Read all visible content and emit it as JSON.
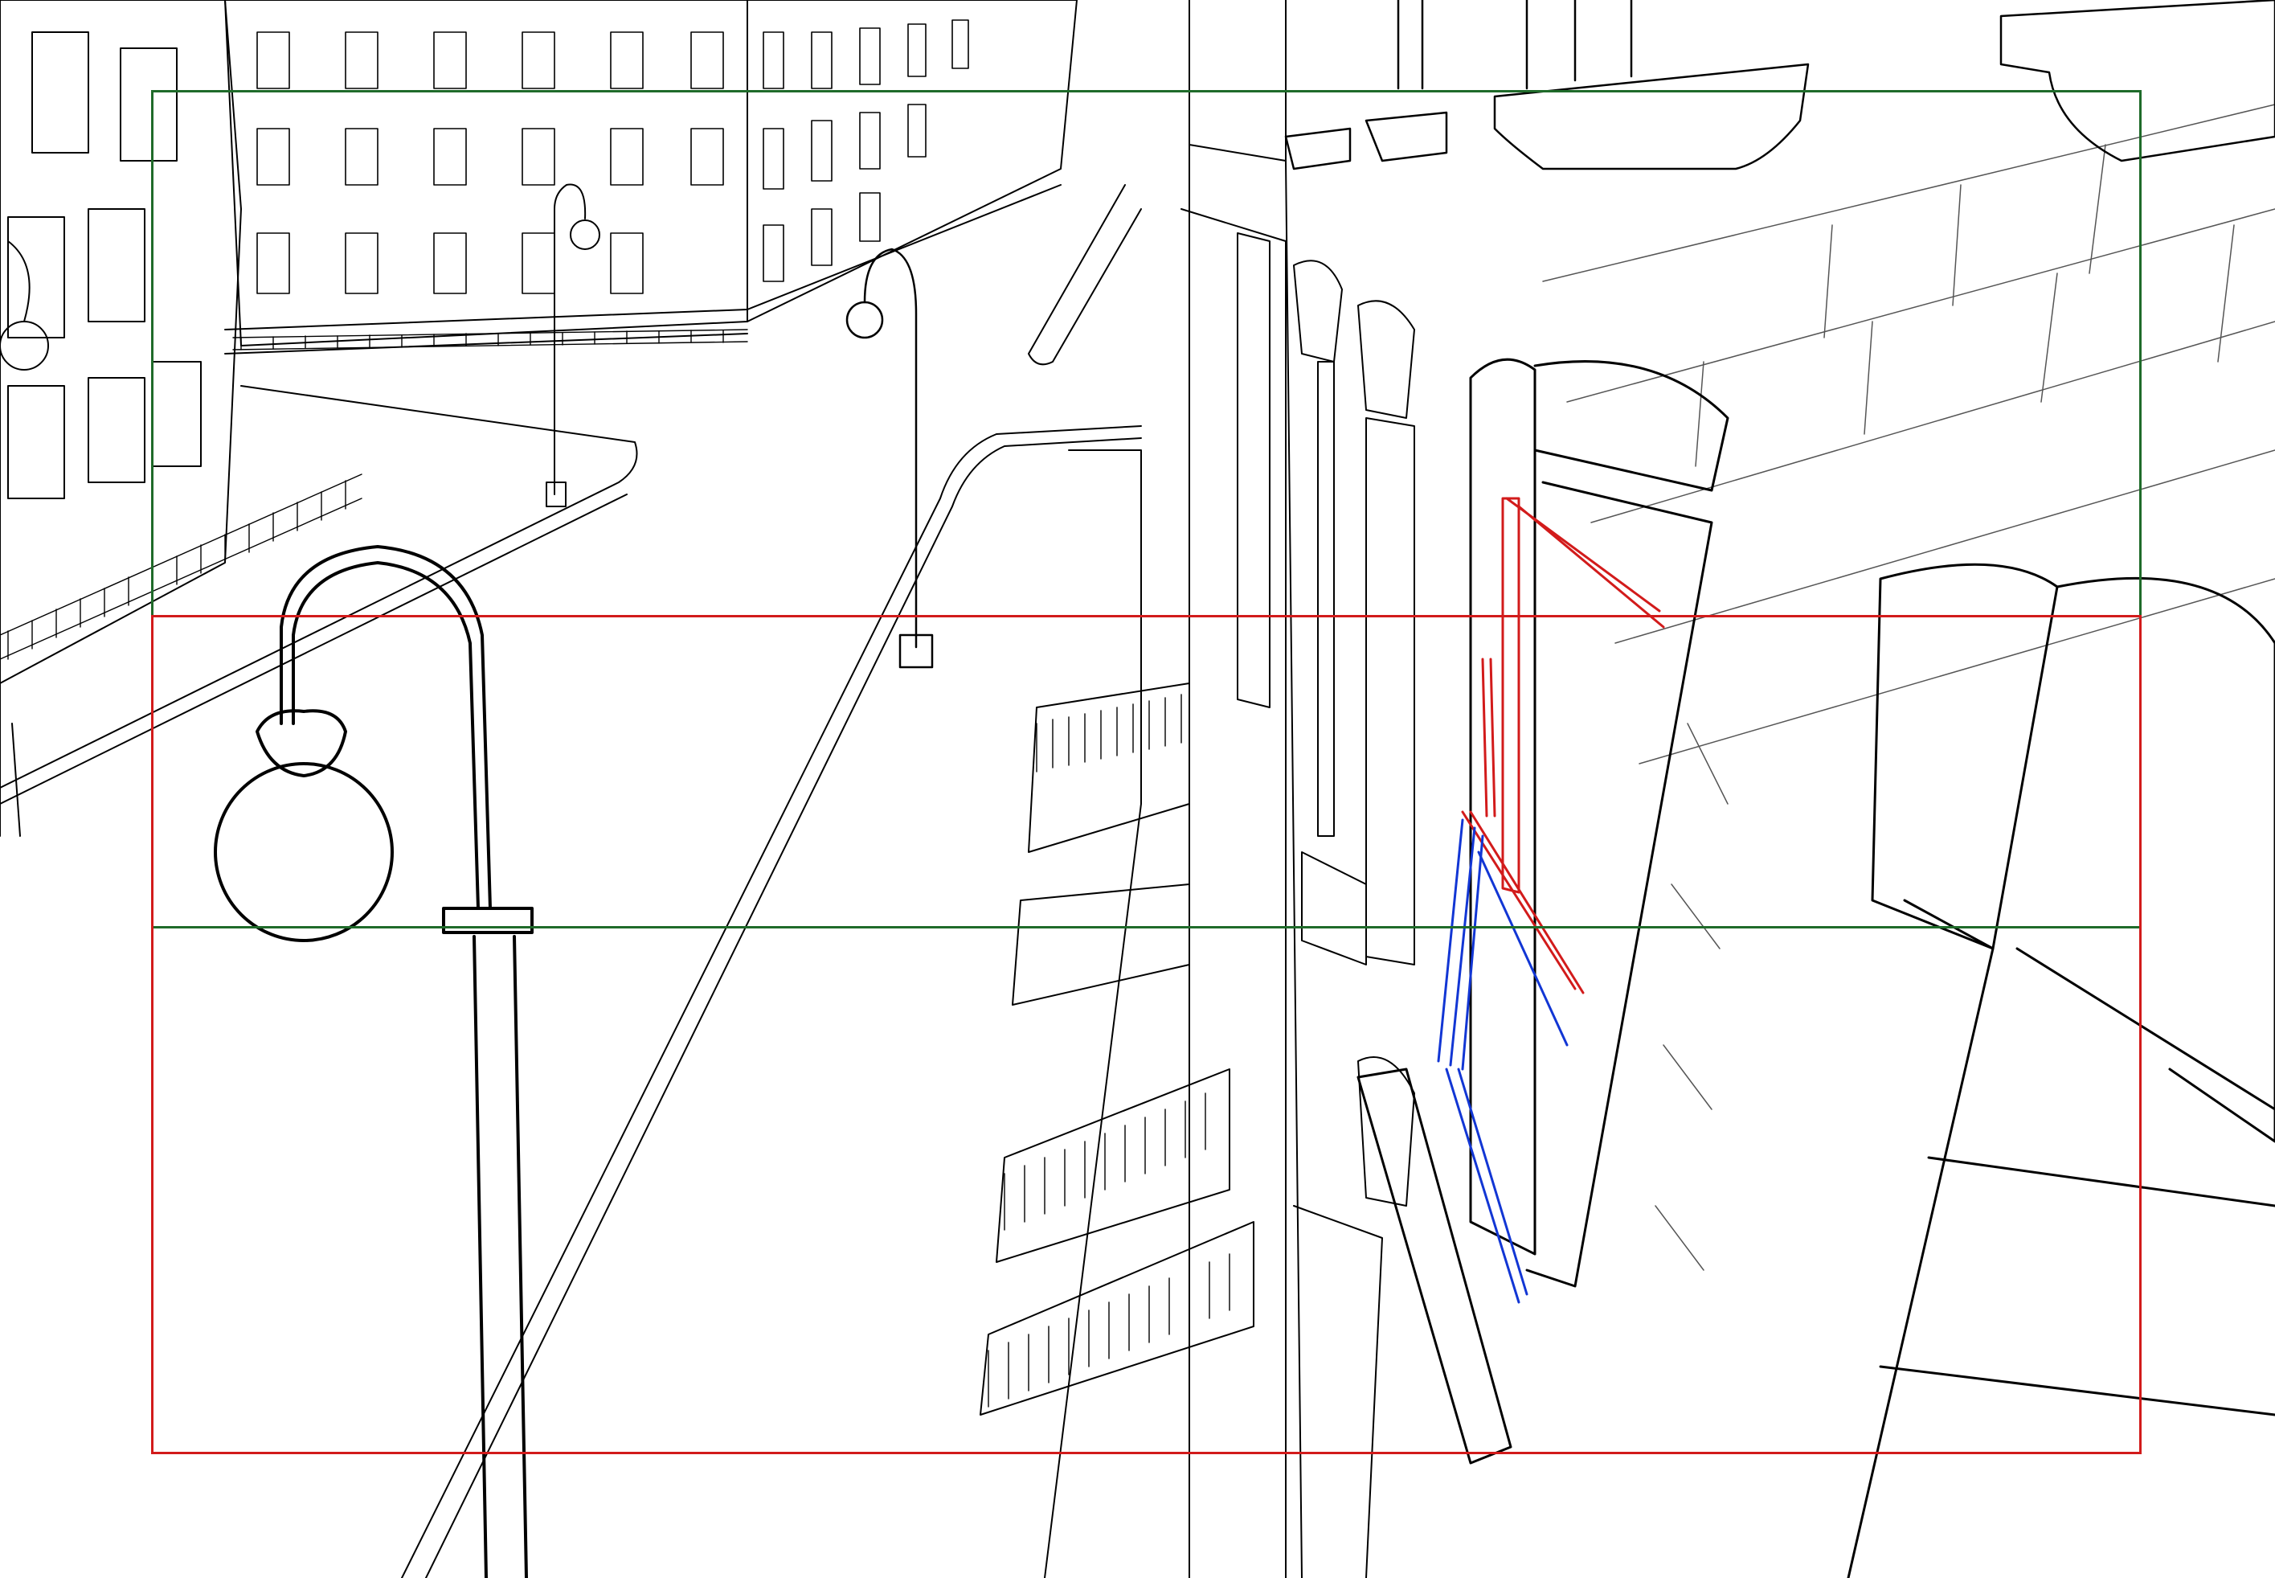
{
  "scene": {
    "subject": "street-perspective-lineart",
    "background": "#ffffff",
    "line_color": "#000000",
    "guide_colors": {
      "frame_green": "#1f6b2a",
      "frame_red": "#d21b1b",
      "highlight_red": "#d21b1b",
      "highlight_blue": "#1236d4"
    },
    "icons": [
      "street-lamp-icon",
      "window-icon",
      "stair-icon",
      "railing-icon"
    ]
  }
}
